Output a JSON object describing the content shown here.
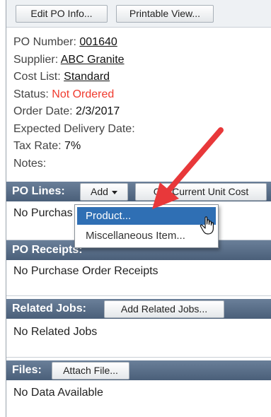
{
  "toolbar": {
    "edit_label": "Edit PO Info...",
    "print_label": "Printable View..."
  },
  "po_info": {
    "number_label": "PO Number:",
    "number_value": "001640",
    "supplier_label": "Supplier:",
    "supplier_value": "ABC Granite",
    "costlist_label": "Cost List:",
    "costlist_value": "Standard",
    "status_label": "Status:",
    "status_value": "Not Ordered",
    "order_date_label": "Order Date:",
    "order_date_value": "2/3/2017",
    "expected_label": "Expected Delivery Date:",
    "tax_label": "Tax Rate:",
    "tax_value": "7%",
    "notes_label": "Notes:"
  },
  "po_lines": {
    "title": "PO Lines:",
    "add_label": "Add",
    "unit_cost_label": "Get Current Unit Cost",
    "empty_text": "No Purchas",
    "dropdown": [
      "Product...",
      "Miscellaneous Item..."
    ]
  },
  "po_receipts": {
    "title": "PO Receipts:",
    "empty_text": "No Purchase Order Receipts"
  },
  "related_jobs": {
    "title": "Related Jobs:",
    "button_label": "Add Related Jobs...",
    "empty_text": "No Related Jobs"
  },
  "files": {
    "title": "Files:",
    "button_label": "Attach File...",
    "empty_text": "No Data Available"
  },
  "colors": {
    "section_header": "#5a6f89",
    "status_red": "#f03a2e",
    "dropdown_highlight": "#2f6fb4",
    "annotation_arrow": "#e8383a"
  },
  "icons": [
    "caret-down-icon",
    "hand-pointer-icon",
    "annotation-arrow"
  ]
}
